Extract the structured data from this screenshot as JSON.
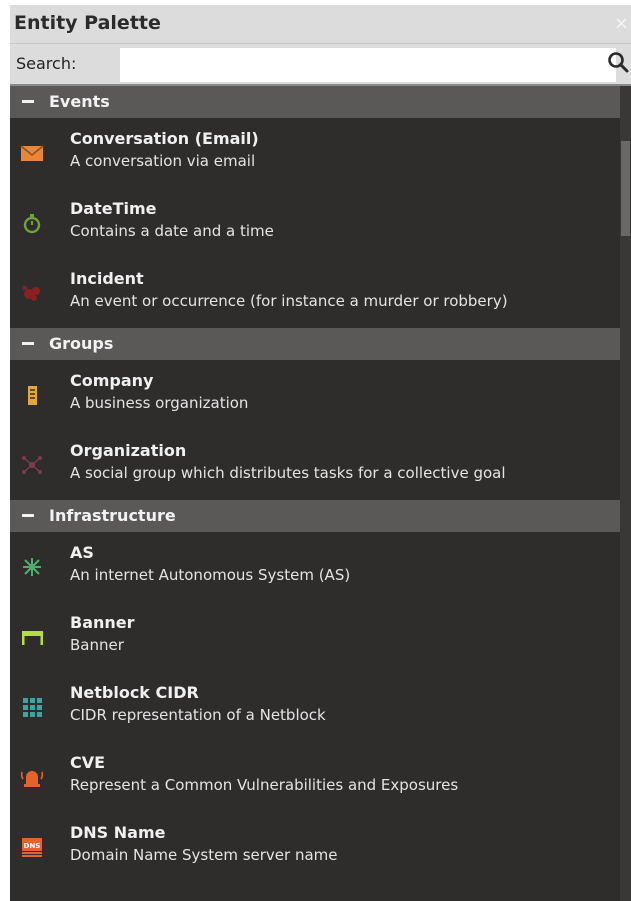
{
  "panel": {
    "title": "Entity Palette",
    "close_glyph": "×"
  },
  "search": {
    "label": "Search:",
    "value": "",
    "placeholder": ""
  },
  "groups": [
    {
      "label": "Events",
      "items": [
        {
          "name": "Conversation (Email)",
          "desc": "A conversation via email",
          "icon": "email-icon"
        },
        {
          "name": "DateTime",
          "desc": "Contains a date and a time",
          "icon": "stopwatch-icon"
        },
        {
          "name": "Incident",
          "desc": "An event or occurrence (for instance a murder or robbery)",
          "icon": "incident-icon"
        }
      ]
    },
    {
      "label": "Groups",
      "items": [
        {
          "name": "Company",
          "desc": "A business organization",
          "icon": "building-icon"
        },
        {
          "name": "Organization",
          "desc": "A social group which distributes tasks for a collective goal",
          "icon": "network-icon"
        }
      ]
    },
    {
      "label": "Infrastructure",
      "items": [
        {
          "name": "AS",
          "desc": "An internet Autonomous System (AS)",
          "icon": "autonomous-system-icon"
        },
        {
          "name": "Banner",
          "desc": "Banner",
          "icon": "banner-icon"
        },
        {
          "name": "Netblock CIDR",
          "desc": "CIDR representation of a Netblock",
          "icon": "netblock-icon"
        },
        {
          "name": "CVE",
          "desc": "Represent a Common Vulnerabilities and Exposures",
          "icon": "alarm-icon"
        },
        {
          "name": "DNS Name",
          "desc": "Domain Name System server name",
          "icon": "dns-icon",
          "icon_text": "DNS"
        }
      ]
    }
  ]
}
